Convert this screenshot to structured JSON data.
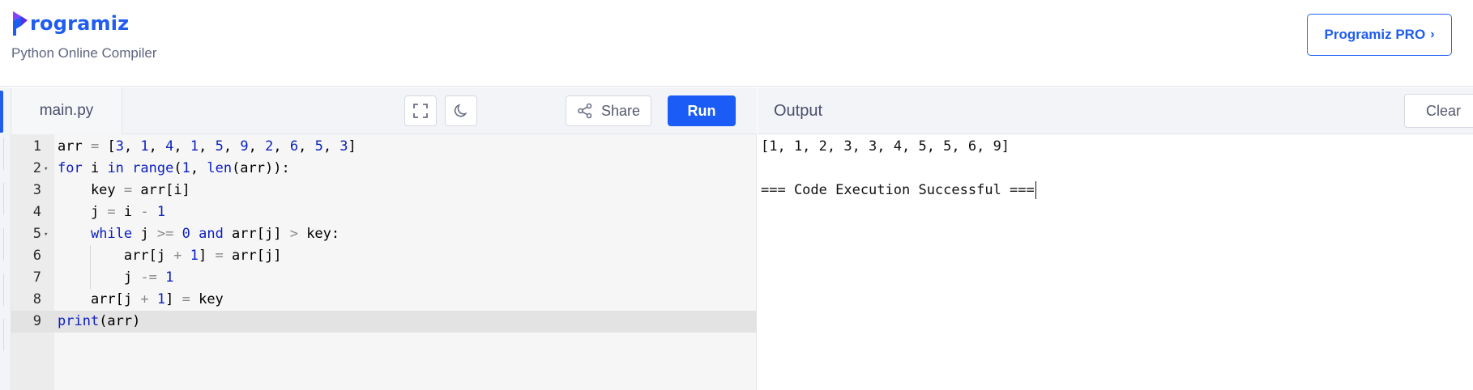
{
  "header": {
    "logo_rest": "rogramiz",
    "subtitle": "Python Online Compiler",
    "pro_button": "Programiz PRO",
    "pro_chevron": "›"
  },
  "editor": {
    "tab": "main.py",
    "share_label": "Share",
    "run_label": "Run",
    "icons": {
      "fullscreen": "fullscreen-icon",
      "theme": "moon-icon",
      "share": "share-icon"
    }
  },
  "output": {
    "title": "Output",
    "clear_label": "Clear",
    "lines": [
      "[1, 1, 2, 3, 3, 4, 5, 5, 6, 9]",
      "",
      "=== Code Execution Successful ==="
    ]
  },
  "code_lines": [
    "arr = [3, 1, 4, 1, 5, 9, 2, 6, 5, 3]",
    "for i in range(1, len(arr)):",
    "    key = arr[i]",
    "    j = i - 1",
    "    while j >= 0 and arr[j] > key:",
    "        arr[j + 1] = arr[j]",
    "        j -= 1",
    "    arr[j + 1] = key",
    "print(arr)"
  ],
  "line_numbers": [
    "1",
    "2",
    "3",
    "4",
    "5",
    "6",
    "7",
    "8",
    "9"
  ],
  "current_line": 9,
  "colors": {
    "brand_blue": "#1f5cf0",
    "run_button": "#1a5cf5",
    "keyword": "#0b1fbf"
  }
}
